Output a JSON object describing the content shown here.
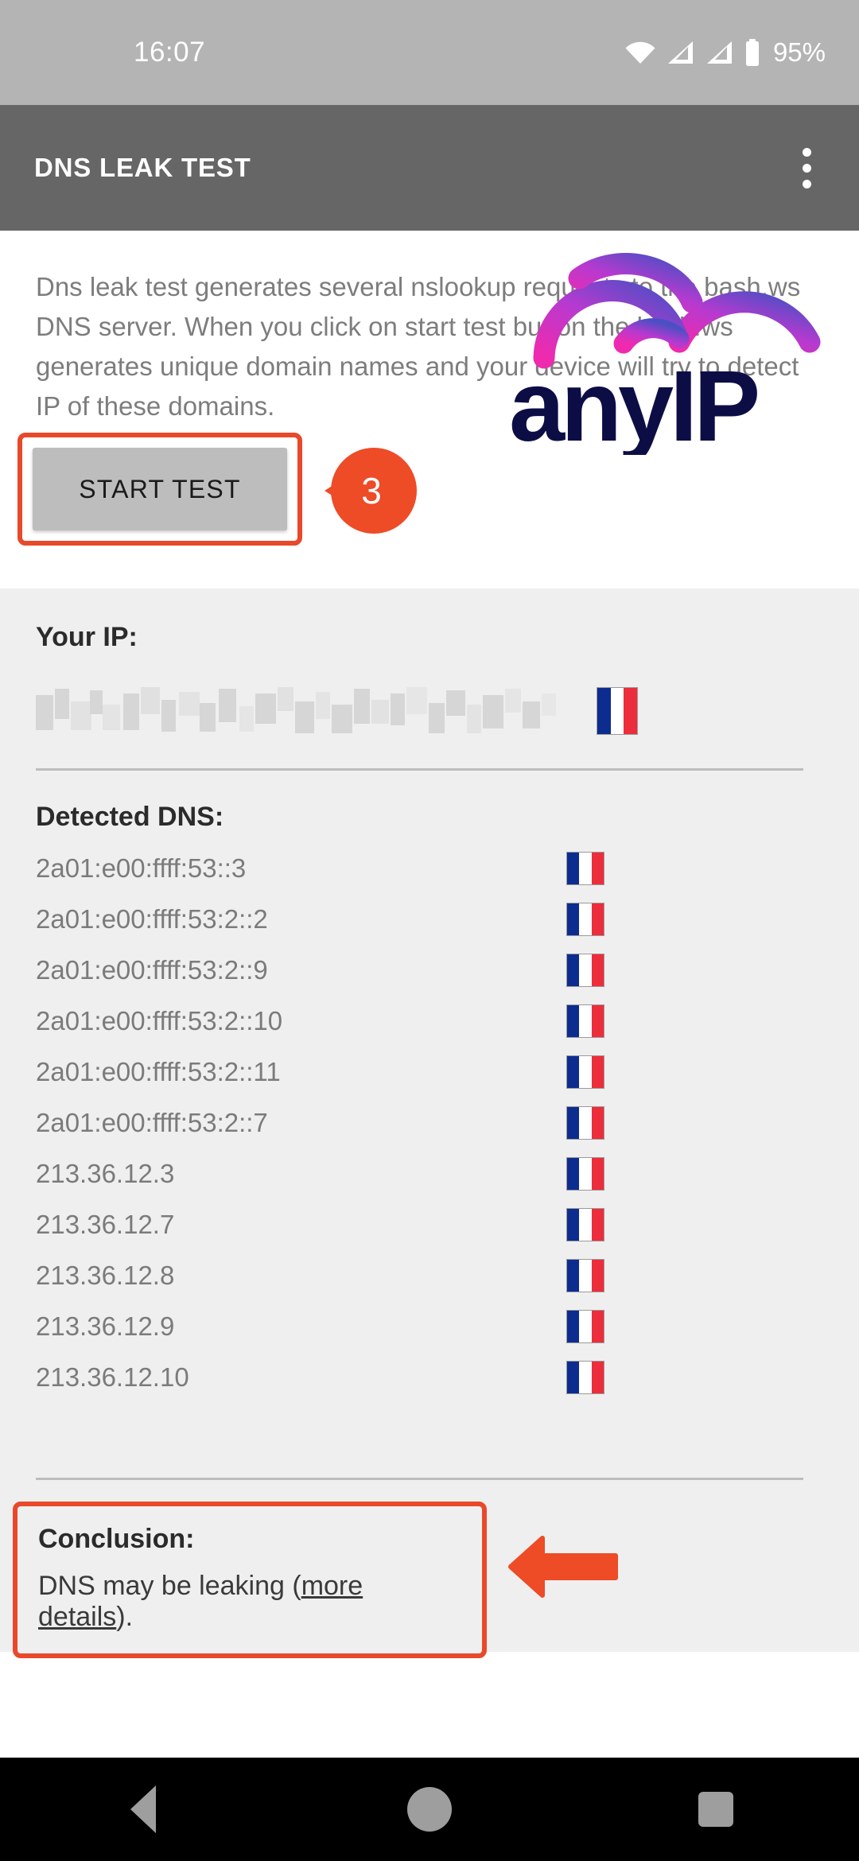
{
  "status_bar": {
    "time": "16:07",
    "battery_percent": "95%",
    "icons": [
      "wifi-icon",
      "signal-icon",
      "signal-icon",
      "battery-icon"
    ]
  },
  "app_bar": {
    "title": "DNS LEAK TEST",
    "overflow_icon": "more-vert-icon"
  },
  "intro": {
    "description": "Dns leak test generates several nslookup requests to the bash.ws DNS server. When you click on start test button the bash.ws generates unique domain names and your device will try to detect IP of these domains.",
    "start_button_label": "START TEST",
    "logo_text": "anyIP"
  },
  "annotations": {
    "step_number": "3",
    "arrow_icon": "arrow-left-icon",
    "highlight_color": "#e8492a"
  },
  "results": {
    "your_ip_label": "Your IP:",
    "your_ip_value": "",
    "your_ip_redacted": true,
    "your_ip_flag": "flag-france",
    "detected_dns_label": "Detected DNS:",
    "dns_entries": [
      {
        "ip": "2a01:e00:ffff:53::3",
        "flag": "flag-france"
      },
      {
        "ip": "2a01:e00:ffff:53:2::2",
        "flag": "flag-france"
      },
      {
        "ip": "2a01:e00:ffff:53:2::9",
        "flag": "flag-france"
      },
      {
        "ip": "2a01:e00:ffff:53:2::10",
        "flag": "flag-france"
      },
      {
        "ip": "2a01:e00:ffff:53:2::11",
        "flag": "flag-france"
      },
      {
        "ip": "2a01:e00:ffff:53:2::7",
        "flag": "flag-france"
      },
      {
        "ip": "213.36.12.3",
        "flag": "flag-france"
      },
      {
        "ip": "213.36.12.7",
        "flag": "flag-france"
      },
      {
        "ip": "213.36.12.8",
        "flag": "flag-france"
      },
      {
        "ip": "213.36.12.9",
        "flag": "flag-france"
      },
      {
        "ip": "213.36.12.10",
        "flag": "flag-france"
      }
    ]
  },
  "conclusion": {
    "title": "Conclusion:",
    "text_before": "DNS may be leaking (",
    "link_text": "more details",
    "text_after": ")."
  },
  "nav_bar": {
    "back_label": "Back",
    "home_label": "Home",
    "recents_label": "Recents"
  }
}
